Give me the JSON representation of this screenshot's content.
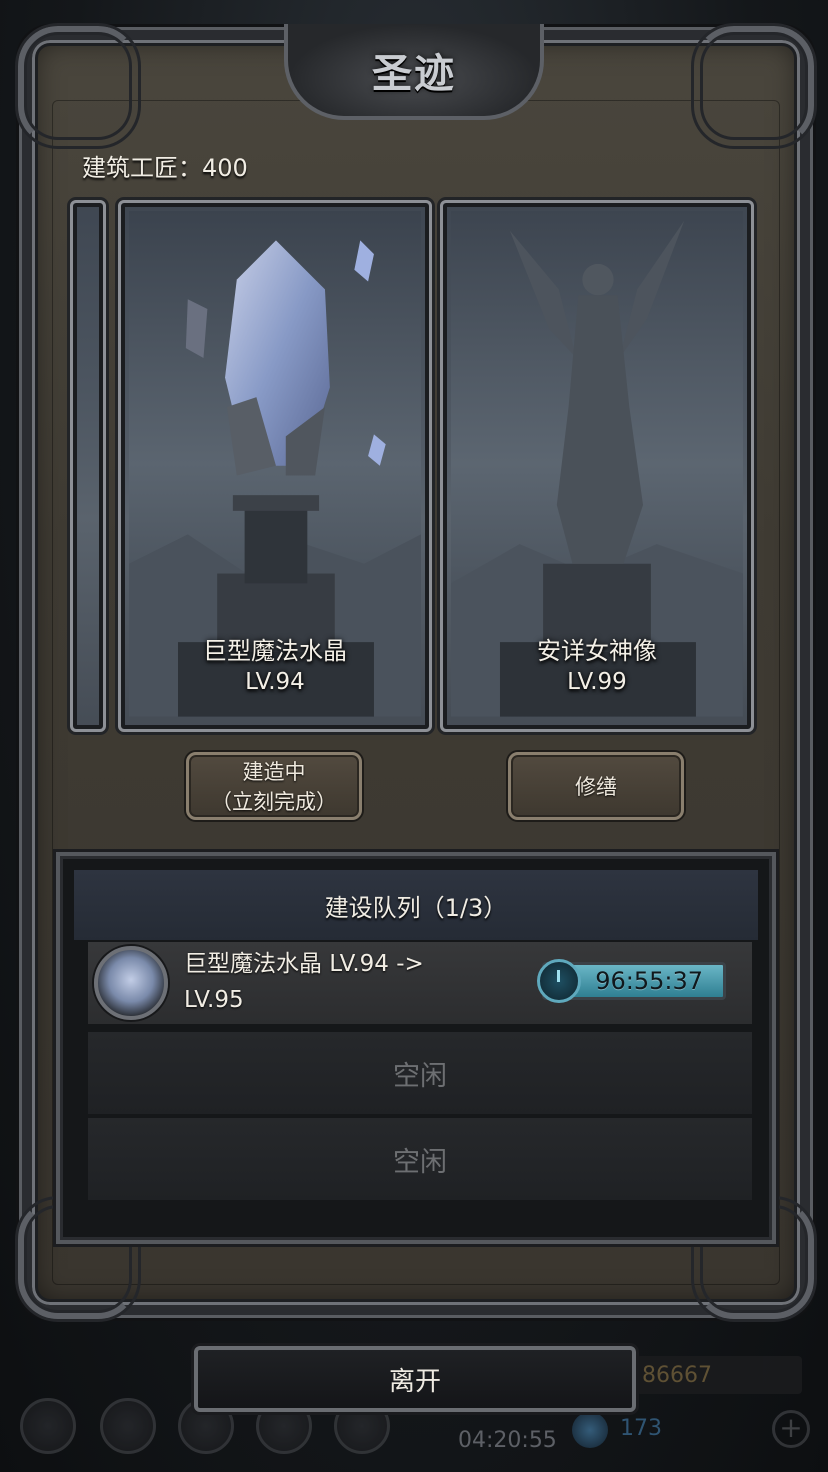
{
  "dialog": {
    "title": "圣迹",
    "builders_label": "建筑工匠：400"
  },
  "cards": [
    {
      "name": "巨型魔法水晶",
      "level": "LV.94",
      "icon": "crystal-monument"
    },
    {
      "name": "安详女神像",
      "level": "LV.99",
      "icon": "angel-statue"
    }
  ],
  "actions": {
    "build_line1": "建造中",
    "build_line2": "（立刻完成）",
    "repair": "修缮"
  },
  "queue": {
    "title": "建设队列（1/3）",
    "task": {
      "text": "巨型魔法水晶 LV.94 -> LV.95",
      "timer": "96:55:37",
      "icon": "crystal-icon"
    },
    "idle_1": "空闲",
    "idle_2": "空闲"
  },
  "leave_button": "离开",
  "hud": {
    "resource_value": "86667",
    "gem_count": "173",
    "clock": "04:20:55",
    "plus": "+"
  },
  "colors": {
    "panel_bg": "#3f3b33",
    "timer_teal": "#4aa0b2",
    "frame_silver": "#8d9096"
  }
}
